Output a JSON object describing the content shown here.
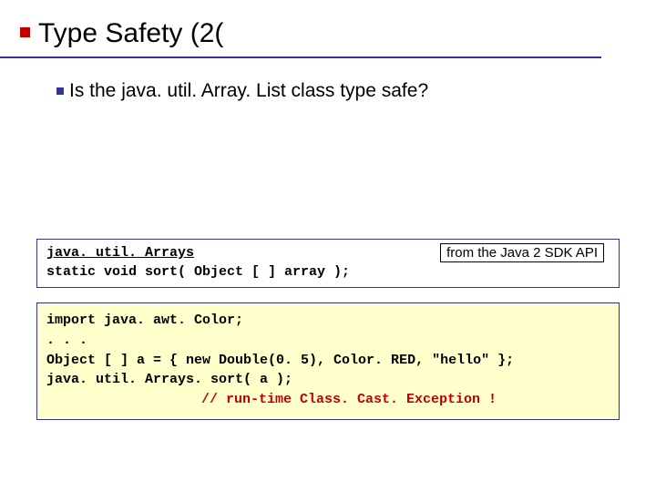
{
  "title": "Type Safety (2(",
  "bullet": "Is the java. util. Array. List class type safe?",
  "api": {
    "class_name": "java. util. Arrays",
    "signature": "static void sort( Object [ ] array );",
    "badge": "from the Java 2 SDK API"
  },
  "code": {
    "line1": "import java. awt. Color;",
    "line2": ". . .",
    "line3": "Object [ ] a = { new Double(0. 5), Color. RED, \"hello\" };",
    "line4": "java. util. Arrays. sort( a );",
    "line5_comment": "// run-time Class. Cast. Exception !"
  }
}
